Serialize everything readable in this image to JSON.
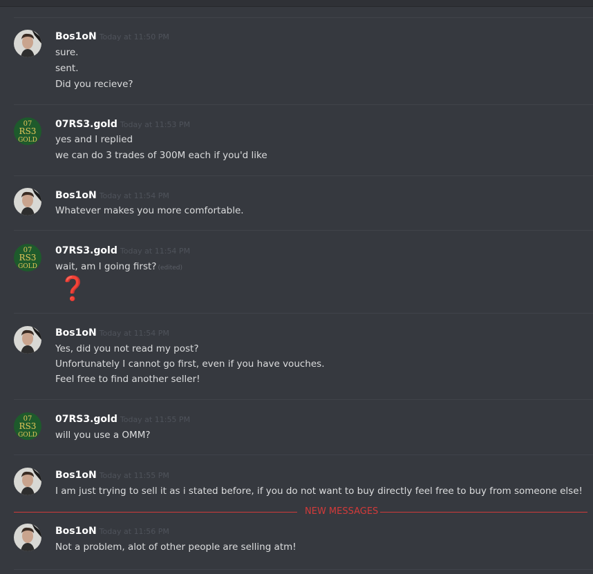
{
  "new_messages_label": "NEW MESSAGES",
  "colors": {
    "background": "#36393f",
    "username": "#ffffff",
    "text": "#dcddde",
    "timestamp": "#4f535b",
    "new_messages": "#d33a3a",
    "emoji": "#d32f45"
  },
  "messages": [
    {
      "author": "Bos1oN",
      "avatar": "bosion-avatar",
      "time": "Today at 11:50 PM",
      "lines": [
        "sure.",
        "sent.",
        "Did you recieve?"
      ]
    },
    {
      "author": "07RS3.gold",
      "avatar": "07rs3-gold-logo-avatar",
      "time": "Today at 11:53 PM",
      "lines": [
        "yes and I replied",
        "we can do 3 trades of 300M each if you'd like"
      ]
    },
    {
      "author": "Bos1oN",
      "avatar": "bosion-avatar",
      "time": "Today at 11:54 PM",
      "lines": [
        "Whatever makes you more comfortable."
      ]
    },
    {
      "author": "07RS3.gold",
      "avatar": "07rs3-gold-logo-avatar",
      "time": "Today at 11:54 PM",
      "lines": [
        "wait, am I going first?"
      ],
      "edited_label": "(edited)",
      "emoji": "❓",
      "emoji_name": "red-question-mark-emoji"
    },
    {
      "author": "Bos1oN",
      "avatar": "bosion-avatar",
      "time": "Today at 11:54 PM",
      "lines": [
        "Yes, did you not read my post?",
        "Unfortunately I cannot go first, even if you have vouches.",
        "Feel free to find another seller!"
      ]
    },
    {
      "author": "07RS3.gold",
      "avatar": "07rs3-gold-logo-avatar",
      "time": "Today at 11:55 PM",
      "lines": [
        "will you use a OMM?"
      ]
    },
    {
      "author": "Bos1oN",
      "avatar": "bosion-avatar",
      "time": "Today at 11:55 PM",
      "lines": [
        "I am just trying to sell it as i stated before, if you do not want to buy directly feel free to buy from someone else!"
      ]
    },
    {
      "author": "Bos1oN",
      "avatar": "bosion-avatar",
      "time": "Today at 11:56 PM",
      "lines": [
        "Not a problem, alot of other people are selling atm!"
      ]
    }
  ],
  "logo_text": {
    "line1": "07",
    "line2": "RS3",
    "line3": "GOLD"
  }
}
